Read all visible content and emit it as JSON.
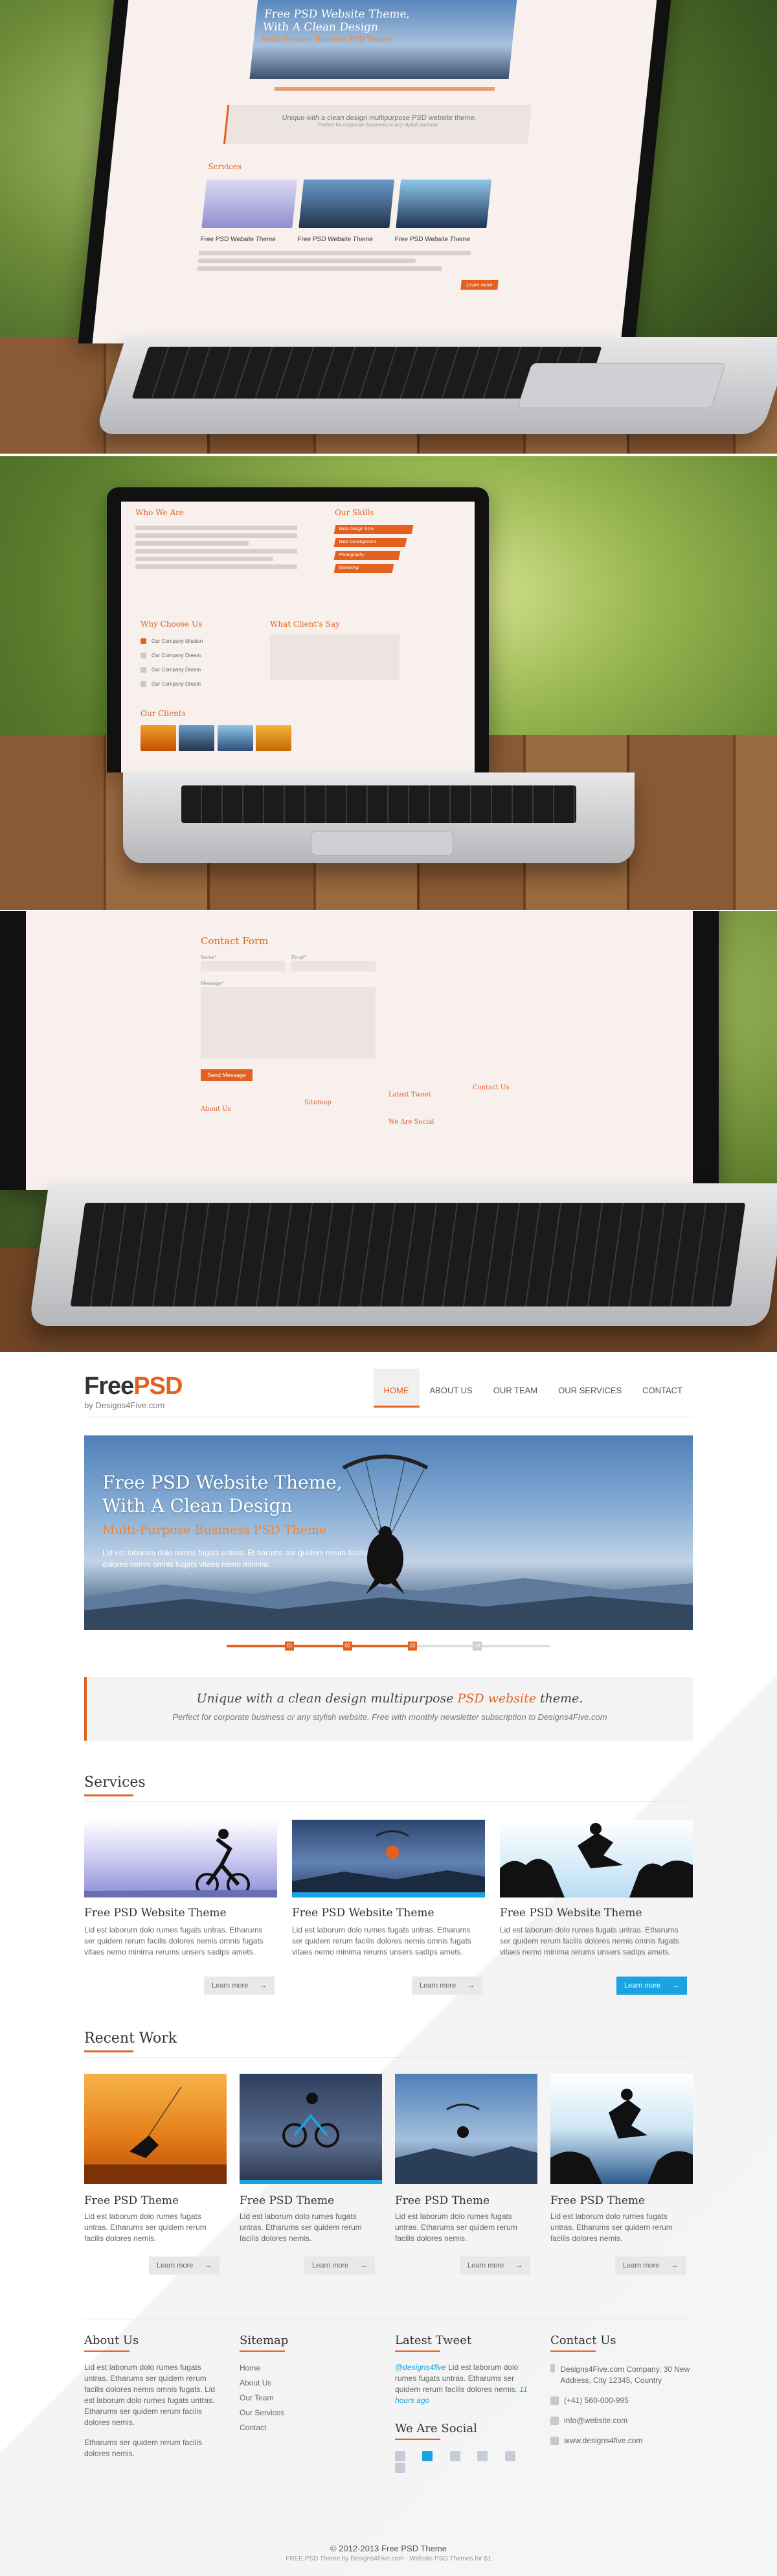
{
  "mockup1": {
    "hero_title": "Free PSD Website Theme, With A Clean Design",
    "hero_sub": "Multi-Purpose Business PSD Theme",
    "tagline": "Unique with a clean design multipurpose PSD website theme.",
    "tagline_sub": "Perfect for corporate business or any stylish website.",
    "services_label": "Services",
    "card_title": "Free PSD Website Theme",
    "learn_more": "Learn more"
  },
  "mockup2": {
    "who_we_are": "Who We Are",
    "our_skills": "Our Skills",
    "why_choose_us": "Why Choose Us",
    "what_clients_say": "What Client's Say",
    "our_clients": "Our Clients",
    "skills": [
      "Web Design 91%",
      "Web Development",
      "Photography",
      "Marketing"
    ],
    "choose_items": [
      "Our Company Mission",
      "Our Company Dream",
      "Our Company Dream",
      "Our Company Dream"
    ]
  },
  "mockup3": {
    "contact_form": "Contact Form",
    "name": "Name*",
    "email": "Email*",
    "message": "Message*",
    "send": "Send Message",
    "about_us": "About Us",
    "sitemap": "Sitemap",
    "latest_tweet": "Latest Tweet",
    "contact_us": "Contact Us",
    "we_are_social": "We Are Social"
  },
  "theme": {
    "logo": {
      "main_a": "Free",
      "main_b": "PSD",
      "sub": "by Designs4Five.com"
    },
    "nav": [
      "HOME",
      "ABOUT US",
      "OUR TEAM",
      "OUR SERVICES",
      "CONTACT"
    ],
    "hero": {
      "title_1": "Free PSD Website Theme,",
      "title_2": "With A Clean Design",
      "subtitle": "Multi-Purpose Business PSD Theme",
      "text": "Lid est laborum dolo rumes fugats untras. Et harums ser quidem rerum facilis dolores nemis omnis fugats vitaes nemo minima."
    },
    "slider_labels": [
      "01",
      "02",
      "03",
      "04"
    ],
    "tagline": {
      "pre": "Unique with a clean design multipurpose ",
      "highlight": "PSD website",
      "post": " theme.",
      "sub": "Perfect for corporate business or any stylish website.  Free with monthly newsletter subscription to Designs4Five.com"
    },
    "services_title": "Services",
    "services": [
      {
        "title": "Free PSD Website Theme",
        "text": "Lid est laborum dolo rumes fugats untras. Etharums ser quidem rerum facilis dolores nemis omnis fugats vitaes nemo minima rerums unsers sadips amets.",
        "button": "Learn more"
      },
      {
        "title": "Free PSD Website Theme",
        "text": "Lid est laborum dolo rumes fugats untras. Etharums ser quidem rerum facilis dolores nemis omnis fugats vitaes nemo minima rerums unsers sadips amets.",
        "button": "Learn more"
      },
      {
        "title": "Free PSD Website Theme",
        "text": "Lid est laborum dolo rumes fugats untras. Etharums ser quidem rerum facilis dolores nemis omnis fugats vitaes nemo minima rerums unsers sadips amets.",
        "button": "Learn more"
      }
    ],
    "work_title": "Recent Work",
    "works": [
      {
        "title": "Free PSD Theme",
        "text": "Lid est laborum dolo rumes fugats untras. Etharums ser quidem rerum facilis dolores nemis.",
        "button": "Learn more"
      },
      {
        "title": "Free PSD Theme",
        "text": "Lid est laborum dolo rumes fugats untras. Etharums ser quidem rerum facilis dolores nemis.",
        "button": "Learn more"
      },
      {
        "title": "Free PSD Theme",
        "text": "Lid est laborum dolo rumes fugats untras. Etharums ser quidem rerum facilis dolores nemis.",
        "button": "Learn more"
      },
      {
        "title": "Free PSD Theme",
        "text": "Lid est laborum dolo rumes fugats untras. Etharums ser quidem rerum facilis dolores nemis.",
        "button": "Learn more"
      }
    ],
    "footer": {
      "about_title": "About Us",
      "about_text_1": "Lid est laborum dolo rumes fugats untras. Etharums ser quidem rerum facilis dolores nemis omnis fugats. Lid est laborum dolo rumes fugats untras. Etharums ser quidem rerum facilis dolores nemis.",
      "about_text_2": "Etharums ser quidem rerum facilis dolores nemis.",
      "sitemap_title": "Sitemap",
      "sitemap": [
        "Home",
        "About Us",
        "Our Team",
        "Our Services",
        "Contact"
      ],
      "tweet_title": "Latest Tweet",
      "tweet_handle": "@designs4five",
      "tweet_text": " Lid est laborum dolo rumes fugats untras. Etharums ser quidem rerum facilis dolores nemis.",
      "tweet_time": "11 hours ago",
      "social_title": "We Are Social",
      "social": [
        "twitter-icon",
        "facebook-icon",
        "dribbble-icon",
        "flickr-icon",
        "vimeo-icon",
        "rss-icon"
      ],
      "contact_title": "Contact Us",
      "address": "Designs4Five.com Company, 30 New Address, City 12345, Country",
      "phone": "(+41) 560-000-995",
      "email": "info@website.com",
      "web": "www.designs4five.com"
    },
    "copyright": "© 2012-2013 Free PSD Theme",
    "credit": "FREE PSD Theme by Designs4Five.com - Website PSD Themes for $1"
  },
  "colors": {
    "accent": "#e3601f",
    "blue": "#1aa3e1",
    "text": "#555555"
  }
}
